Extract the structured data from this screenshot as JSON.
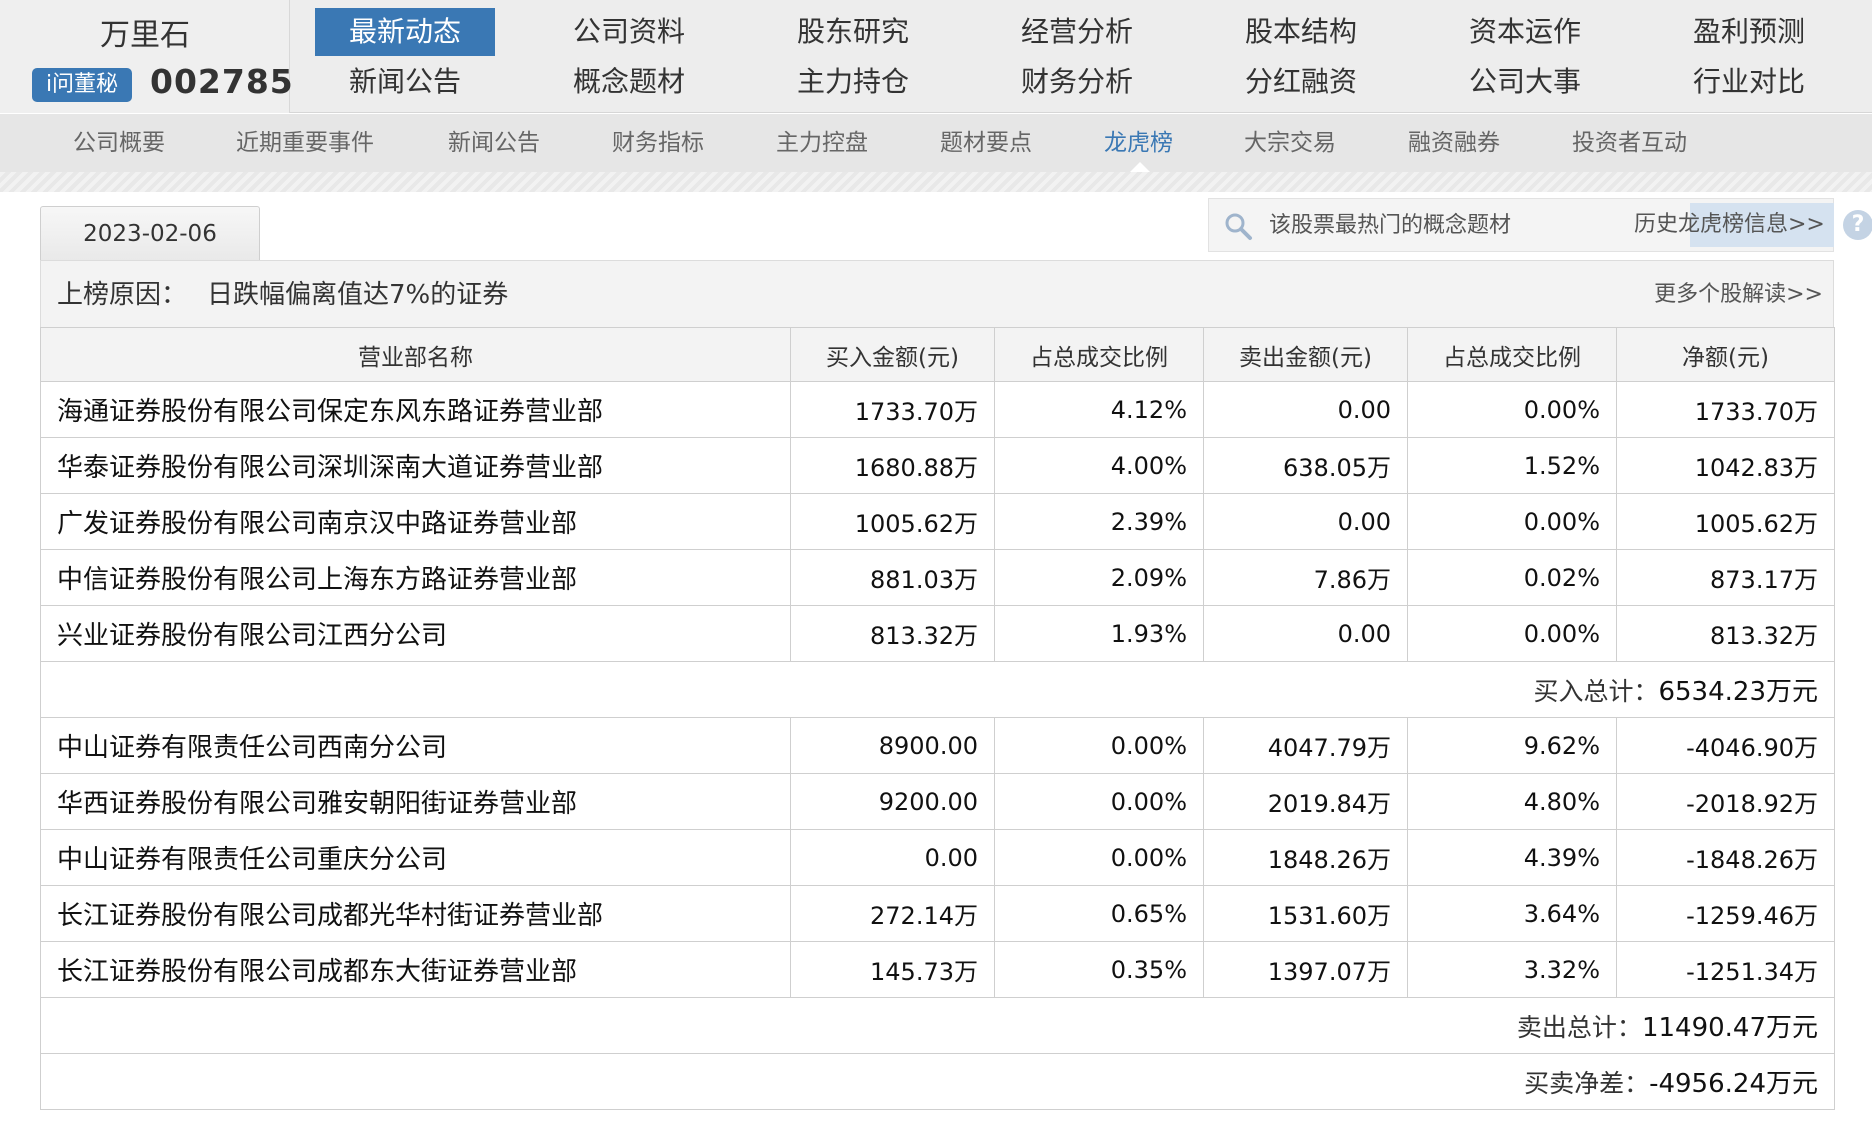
{
  "header": {
    "company_name": "万里石",
    "ask_button": "i问董秘",
    "stock_code": "002785",
    "nav_row1": [
      "最新动态",
      "公司资料",
      "股东研究",
      "经营分析",
      "股本结构",
      "资本运作",
      "盈利预测"
    ],
    "nav_row2": [
      "新闻公告",
      "概念题材",
      "主力持仓",
      "财务分析",
      "分红融资",
      "公司大事",
      "行业对比"
    ],
    "active_nav": "最新动态"
  },
  "subnav": {
    "items": [
      "公司概要",
      "近期重要事件",
      "新闻公告",
      "财务指标",
      "主力控盘",
      "题材要点",
      "龙虎榜",
      "大宗交易",
      "融资融券",
      "投资者互动"
    ],
    "active": "龙虎榜"
  },
  "toolbar": {
    "date": "2023-02-06",
    "search_text": "该股票最热门的概念题材",
    "history_link": "历史龙虎榜信息>>",
    "help": "?"
  },
  "reason": {
    "label": "上榜原因：",
    "text": "日跌幅偏离值达7%的证券",
    "more_link": "更多个股解读>>"
  },
  "table": {
    "headers": [
      "营业部名称",
      "买入金额(元)",
      "占总成交比例",
      "卖出金额(元)",
      "占总成交比例",
      "净额(元)"
    ],
    "buy_rows": [
      [
        "海通证券股份有限公司保定东风东路证券营业部",
        "1733.70万",
        "4.12%",
        "0.00",
        "0.00%",
        "1733.70万"
      ],
      [
        "华泰证券股份有限公司深圳深南大道证券营业部",
        "1680.88万",
        "4.00%",
        "638.05万",
        "1.52%",
        "1042.83万"
      ],
      [
        "广发证券股份有限公司南京汉中路证券营业部",
        "1005.62万",
        "2.39%",
        "0.00",
        "0.00%",
        "1005.62万"
      ],
      [
        "中信证券股份有限公司上海东方路证券营业部",
        "881.03万",
        "2.09%",
        "7.86万",
        "0.02%",
        "873.17万"
      ],
      [
        "兴业证券股份有限公司江西分公司",
        "813.32万",
        "1.93%",
        "0.00",
        "0.00%",
        "813.32万"
      ]
    ],
    "buy_total_label": "买入总计：",
    "buy_total_value": "6534.23万元",
    "sell_rows": [
      [
        "中山证券有限责任公司西南分公司",
        "8900.00",
        "0.00%",
        "4047.79万",
        "9.62%",
        "-4046.90万"
      ],
      [
        "华西证券股份有限公司雅安朝阳街证券营业部",
        "9200.00",
        "0.00%",
        "2019.84万",
        "4.80%",
        "-2018.92万"
      ],
      [
        "中山证券有限责任公司重庆分公司",
        "0.00",
        "0.00%",
        "1848.26万",
        "4.39%",
        "-1848.26万"
      ],
      [
        "长江证券股份有限公司成都光华村街证券营业部",
        "272.14万",
        "0.65%",
        "1531.60万",
        "3.64%",
        "-1259.46万"
      ],
      [
        "长江证券股份有限公司成都东大街证券营业部",
        "145.73万",
        "0.35%",
        "1397.07万",
        "3.32%",
        "-1251.34万"
      ]
    ],
    "sell_total_label": "卖出总计：",
    "sell_total_value": "11490.47万元",
    "net_label": "买卖净差：",
    "net_value": "-4956.24万元"
  },
  "colors": {
    "accent": "#3a78b4",
    "header_bg": "#ededed",
    "subnav_bg": "#e6e6e6"
  }
}
